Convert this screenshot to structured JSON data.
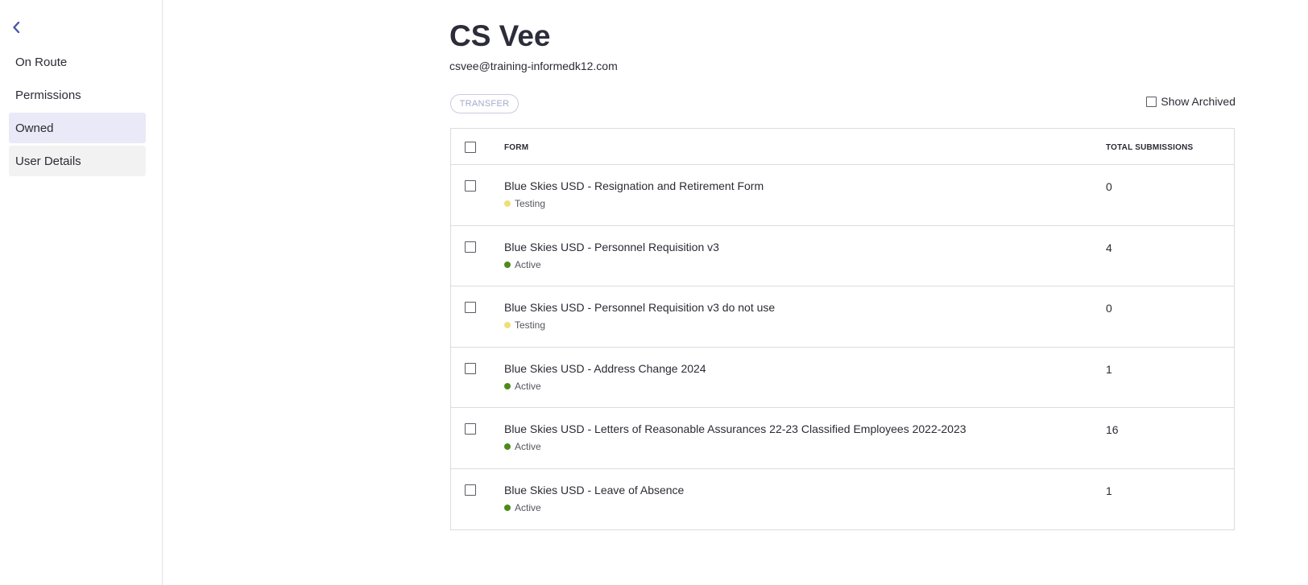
{
  "sidebar": {
    "items": [
      {
        "label": "On Route"
      },
      {
        "label": "Permissions"
      },
      {
        "label": "Owned"
      },
      {
        "label": "User Details"
      }
    ]
  },
  "user": {
    "name": "CS Vee",
    "email": "csvee@training-informedk12.com"
  },
  "toolbar": {
    "transfer_label": "TRANSFER",
    "show_archived_label": "Show Archived"
  },
  "table": {
    "headers": {
      "form": "FORM",
      "total": "TOTAL SUBMISSIONS"
    },
    "rows": [
      {
        "title": "Blue Skies USD - Resignation and Retirement Form",
        "status": "Testing",
        "count": "0"
      },
      {
        "title": "Blue Skies USD - Personnel Requisition v3",
        "status": "Active",
        "count": "4"
      },
      {
        "title": "Blue Skies USD - Personnel Requisition v3 do not use",
        "status": "Testing",
        "count": "0"
      },
      {
        "title": "Blue Skies USD - Address Change 2024",
        "status": "Active",
        "count": "1"
      },
      {
        "title": "Blue Skies USD - Letters of Reasonable Assurances 22-23 Classified Employees 2022-2023",
        "status": "Active",
        "count": "16"
      },
      {
        "title": "Blue Skies USD - Leave of Absence",
        "status": "Active",
        "count": "1"
      }
    ]
  },
  "colors": {
    "accent": "#4a56a6",
    "status_testing": "#ede07a",
    "status_active": "#4e8a1a",
    "nav_active_bg": "#e9e9f7"
  },
  "icons": {
    "back": "chevron-left-icon"
  }
}
